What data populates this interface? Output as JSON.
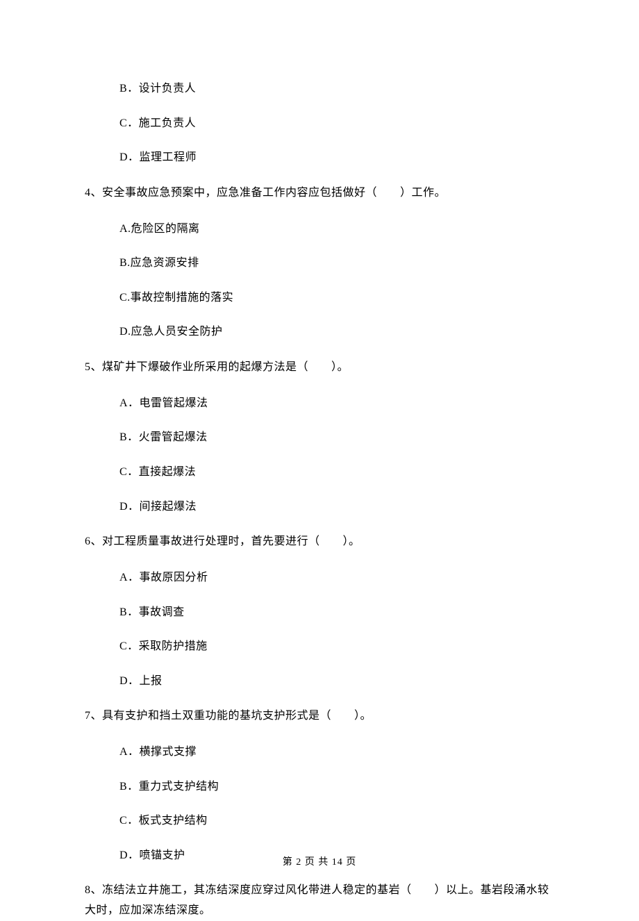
{
  "prevOptions": [
    "B．设计负责人",
    "C．施工负责人",
    "D．监理工程师"
  ],
  "questions": [
    {
      "stem": "4、安全事故应急预案中，应急准备工作内容应包括做好（　　）工作。",
      "options": [
        "A.危险区的隔离",
        "B.应急资源安排",
        "C.事故控制措施的落实",
        "D.应急人员安全防护"
      ]
    },
    {
      "stem": "5、煤矿井下爆破作业所采用的起爆方法是（　　）。",
      "options": [
        "A．电雷管起爆法",
        "B．火雷管起爆法",
        "C．直接起爆法",
        "D．间接起爆法"
      ]
    },
    {
      "stem": "6、对工程质量事故进行处理时，首先要进行（　　）。",
      "options": [
        "A．事故原因分析",
        "B．事故调查",
        "C．采取防护措施",
        "D．上报"
      ]
    },
    {
      "stem": "7、具有支护和挡土双重功能的基坑支护形式是（　　）。",
      "options": [
        "A．横撑式支撑",
        "B．重力式支护结构",
        "C．板式支护结构",
        "D．喷锚支护"
      ]
    },
    {
      "stem": "8、冻结法立井施工，其冻结深度应穿过风化带进人稳定的基岩（　　）以上。基岩段涌水较大时，应加深冻结深度。",
      "options": []
    }
  ],
  "footer": "第 2 页 共 14 页"
}
